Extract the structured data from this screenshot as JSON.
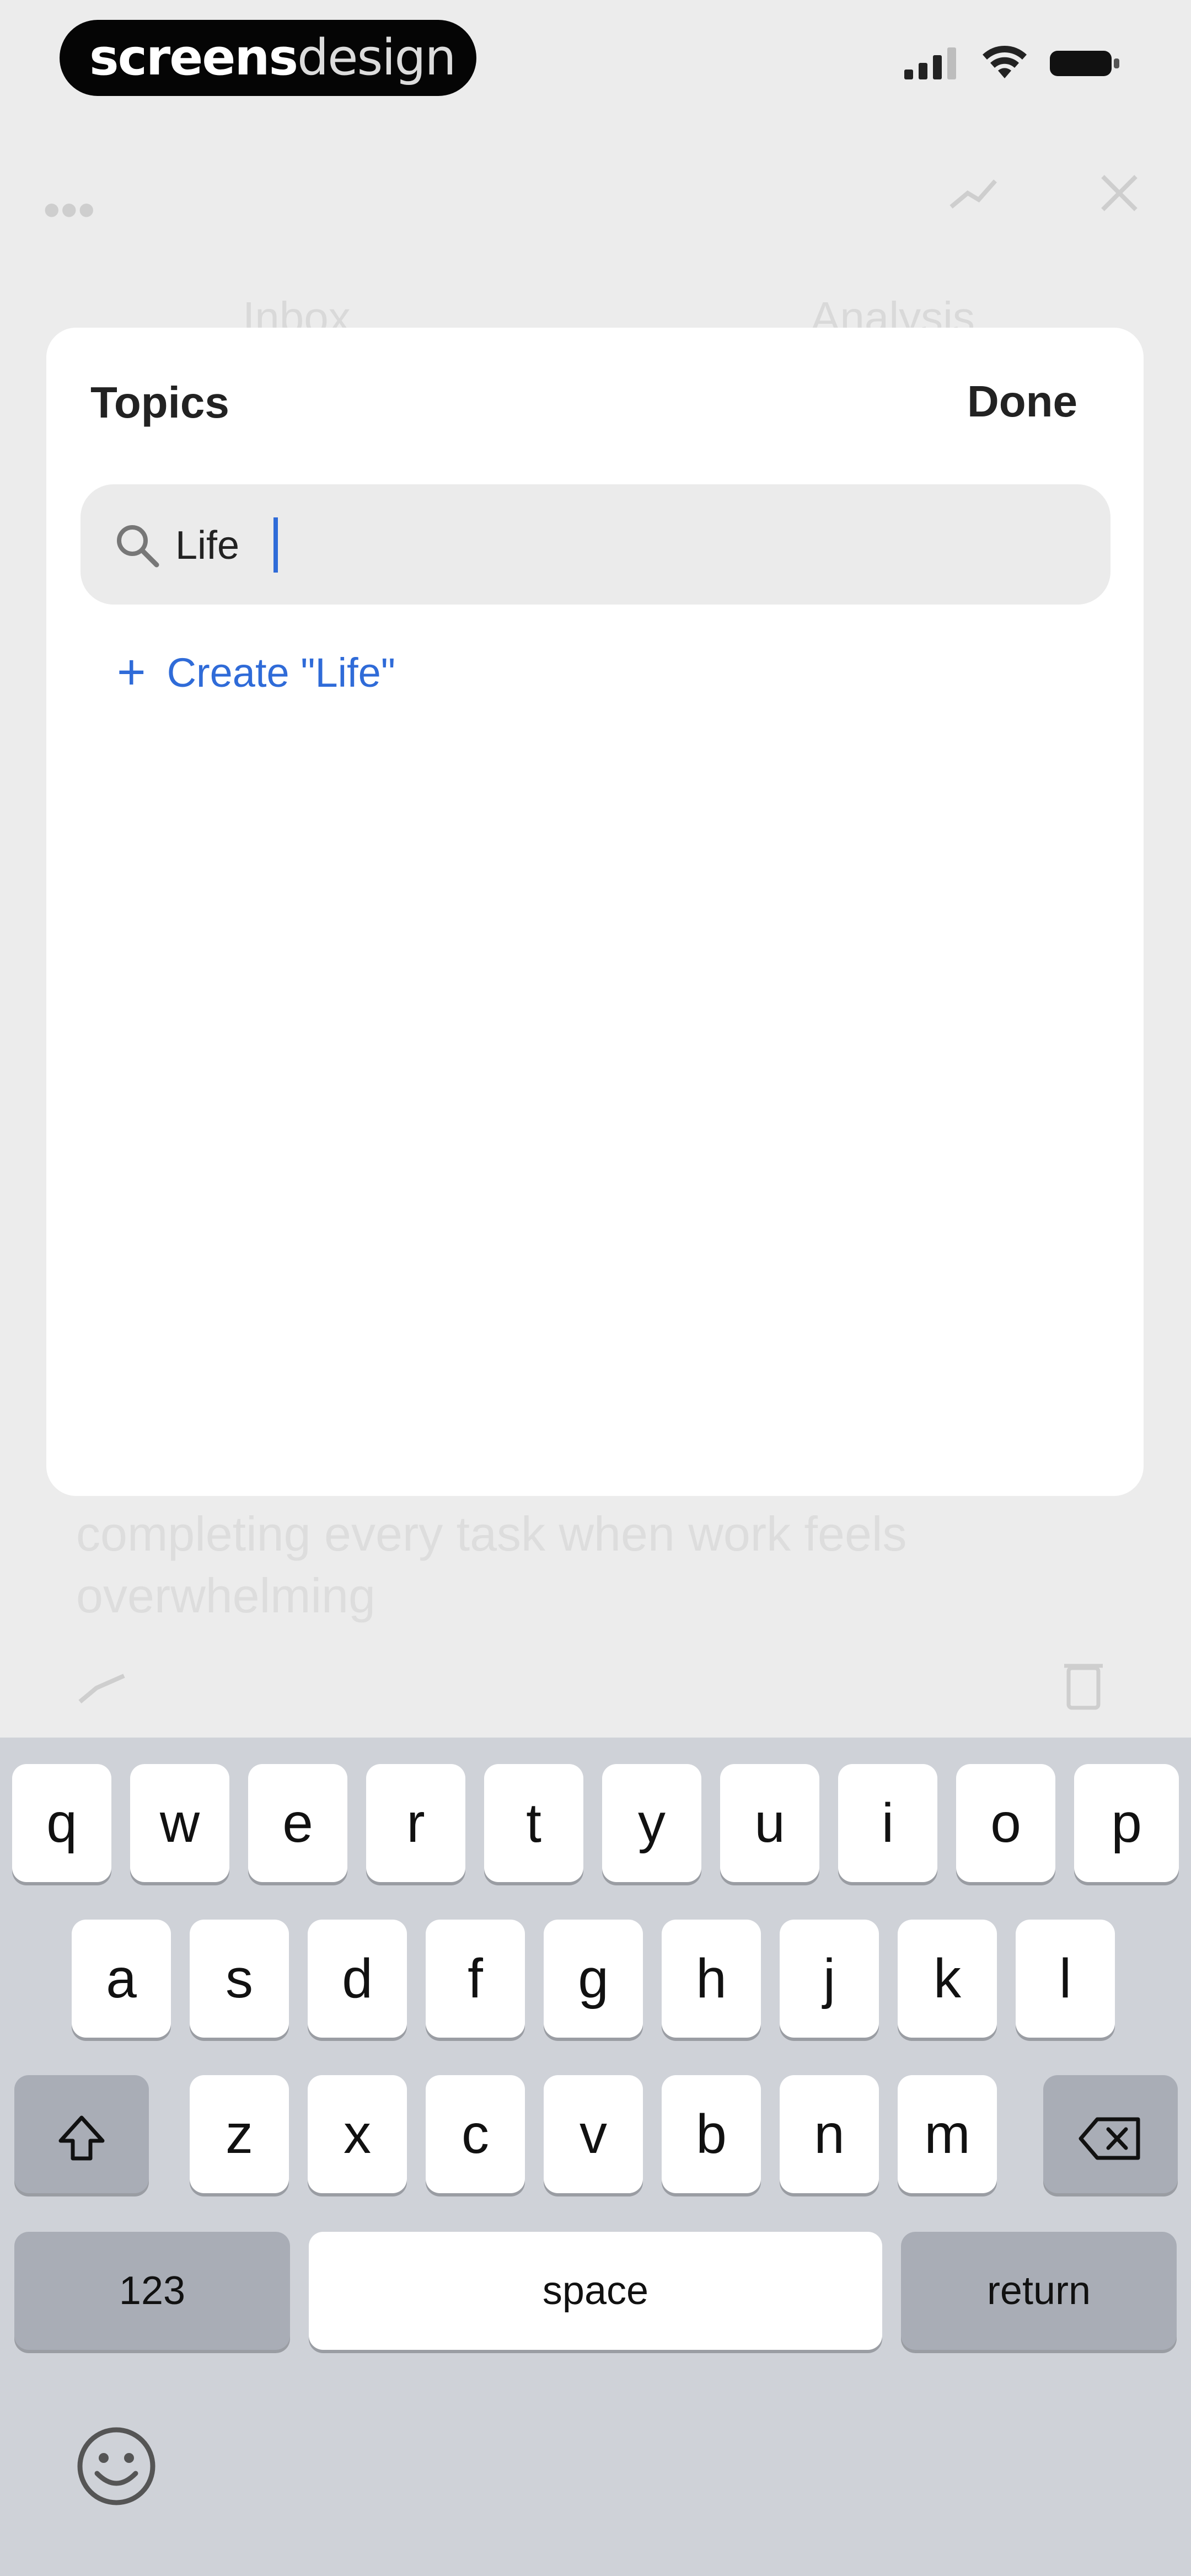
{
  "watermark": {
    "part1": "screens",
    "part2": "design"
  },
  "status_bar": {
    "signal_icon": "signal-icon",
    "wifi_icon": "wifi-icon",
    "battery_icon": "battery-icon"
  },
  "background": {
    "tab_left": "Inbox",
    "tab_right": "Analysis",
    "text_line1": "completing every task when work feels",
    "text_line2": "overwhelming"
  },
  "sheet": {
    "title": "Topics",
    "done_label": "Done",
    "search": {
      "value": "Life",
      "placeholder": ""
    },
    "create_label": "Create \"Life\"",
    "accent_color": "#2f6bd8"
  },
  "keyboard": {
    "row1": [
      "q",
      "w",
      "e",
      "r",
      "t",
      "y",
      "u",
      "i",
      "o",
      "p"
    ],
    "row2": [
      "a",
      "s",
      "d",
      "f",
      "g",
      "h",
      "j",
      "k",
      "l"
    ],
    "row3": [
      "z",
      "x",
      "c",
      "v",
      "b",
      "n",
      "m"
    ],
    "numbers_label": "123",
    "space_label": "space",
    "return_label": "return"
  }
}
